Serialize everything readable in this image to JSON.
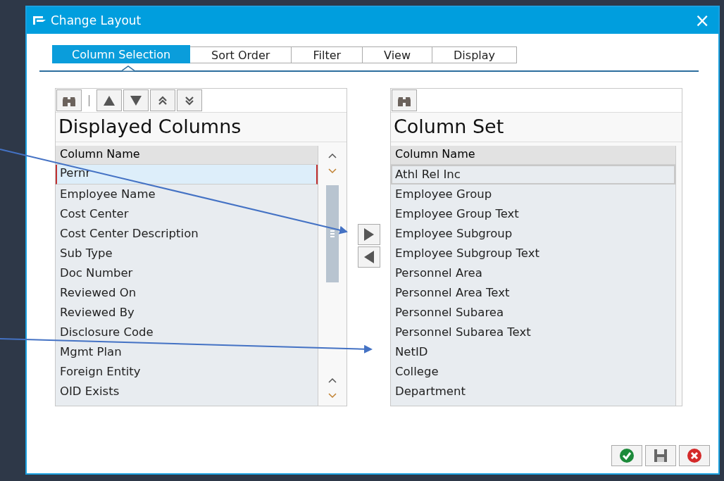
{
  "window": {
    "title": "Change Layout",
    "close": "×"
  },
  "tabs": [
    {
      "label": "Column Selection",
      "selected": true
    },
    {
      "label": "Sort Order",
      "selected": false
    },
    {
      "label": "Filter",
      "selected": false
    },
    {
      "label": "View",
      "selected": false
    },
    {
      "label": "Display",
      "selected": false
    }
  ],
  "displayed_columns": {
    "title": "Displayed Columns",
    "column_header": "Column Name",
    "rows": [
      {
        "label": "Pernr",
        "selected": true
      },
      {
        "label": "Employee Name",
        "selected": false
      },
      {
        "label": "Cost Center",
        "selected": false
      },
      {
        "label": "Cost Center Description",
        "selected": false
      },
      {
        "label": "Sub Type",
        "selected": false
      },
      {
        "label": "Doc Number",
        "selected": false
      },
      {
        "label": "Reviewed On",
        "selected": false
      },
      {
        "label": "Reviewed By",
        "selected": false
      },
      {
        "label": "Disclosure Code",
        "selected": false
      },
      {
        "label": "Mgmt Plan",
        "selected": false
      },
      {
        "label": "Foreign Entity",
        "selected": false
      },
      {
        "label": "OID Exists",
        "selected": false
      }
    ]
  },
  "column_set": {
    "title": "Column Set",
    "column_header": "Column Name",
    "rows": [
      {
        "label": "Athl Rel Inc",
        "selected": true
      },
      {
        "label": "Employee Group",
        "selected": false
      },
      {
        "label": "Employee Group Text",
        "selected": false
      },
      {
        "label": "Employee Subgroup",
        "selected": false
      },
      {
        "label": "Employee Subgroup Text",
        "selected": false
      },
      {
        "label": "Personnel Area",
        "selected": false
      },
      {
        "label": "Personnel Area Text",
        "selected": false
      },
      {
        "label": "Personnel Subarea",
        "selected": false
      },
      {
        "label": "Personnel Subarea Text",
        "selected": false
      },
      {
        "label": "NetID",
        "selected": false
      },
      {
        "label": "College",
        "selected": false
      },
      {
        "label": "Department",
        "selected": false
      }
    ]
  }
}
